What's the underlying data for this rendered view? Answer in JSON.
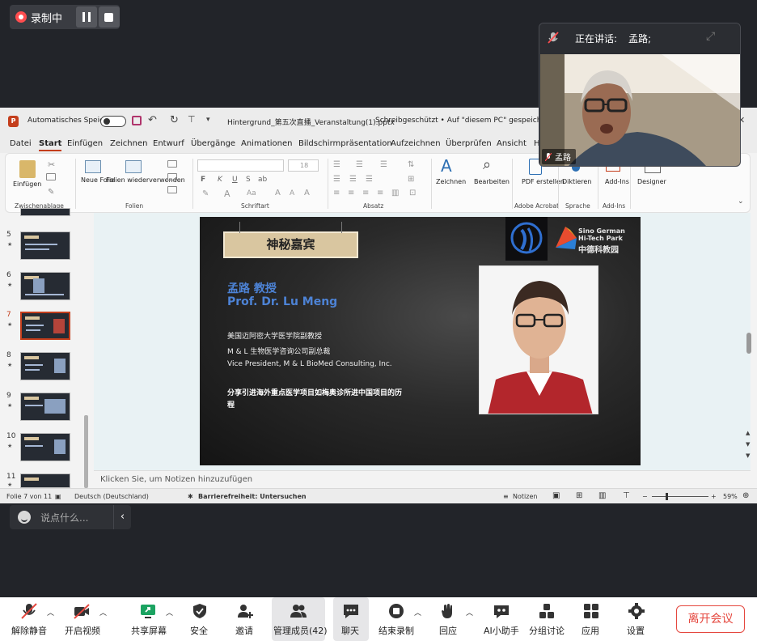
{
  "recording": {
    "label": "录制中"
  },
  "ppt": {
    "autosave_label": "Automatisches Speichern",
    "file_title": "Hintergrund_第五次直播_Veranstaltung(1).pptx",
    "status": "Schreibgeschützt • Auf \"diesem PC\" gespeichert",
    "tabs": [
      "Datei",
      "Start",
      "Einfügen",
      "Zeichnen",
      "Entwurf",
      "Übergänge",
      "Animationen",
      "Bildschirmpräsentation",
      "Aufzeichnen",
      "Überprüfen",
      "Ansicht",
      "H"
    ],
    "ribbon": {
      "einfuegen": "Einfügen",
      "zwischenablage": "Zwischenablage",
      "neue_folie": "Neue Folie",
      "folien_wieder": "Folien wiederverwenden",
      "folien": "Folien",
      "schriftart": "Schriftart",
      "absatz": "Absatz",
      "zeichnen": "Zeichnen",
      "bearbeiten": "Bearbeiten",
      "pdf": "PDF erstellen",
      "adobe": "Adobe Acrobat",
      "diktieren": "Diktieren",
      "sprache": "Sprache",
      "addins": "Add-Ins",
      "addins_group": "Add-Ins",
      "designer": "Designer",
      "font_size": "18",
      "bold": "F",
      "italic": "K",
      "underline": "U",
      "strike": "S",
      "ab": "ab"
    },
    "thumbnails": [
      {
        "num": "5"
      },
      {
        "num": "6"
      },
      {
        "num": "7"
      },
      {
        "num": "8"
      },
      {
        "num": "9"
      },
      {
        "num": "10"
      },
      {
        "num": "11"
      }
    ],
    "notes_placeholder": "Klicken Sie, um Notizen hinzuzufügen",
    "statusbar": {
      "slide_pos": "Folie 7 von 11",
      "language": "Deutsch (Deutschland)",
      "accessibility": "Barrierefreiheit: Untersuchen",
      "notes": "Notizen",
      "zoom": "59%"
    },
    "slide": {
      "tag": "神秘嘉宾",
      "name_cn": "孟路 教授",
      "name_en": "Prof. Dr. Lu Meng",
      "line1": "美国迈阿密大学医学院副教授",
      "line2": "M & L 生物医学咨询公司副总裁",
      "line3": "Vice President, M & L BioMed Consulting, Inc.",
      "highlight": "分享引进海外重点医学项目如梅奥诊所进中国项目的历程",
      "logo_en": "Sino German\nHi-Tech Park",
      "logo_cn": "中德科教园"
    }
  },
  "speaker": {
    "label": "正在讲话:",
    "name": "孟路;",
    "tile_name": "孟路"
  },
  "chat": {
    "placeholder": "说点什么..."
  },
  "toolbar": {
    "unmute": "解除静音",
    "video": "开启视频",
    "share": "共享屏幕",
    "security": "安全",
    "invite": "邀请",
    "members": "管理成员(42)",
    "chat": "聊天",
    "stop_rec": "结束录制",
    "react": "回应",
    "ai": "AI小助手",
    "breakout": "分组讨论",
    "apps": "应用",
    "settings": "设置",
    "leave": "离开会议"
  }
}
